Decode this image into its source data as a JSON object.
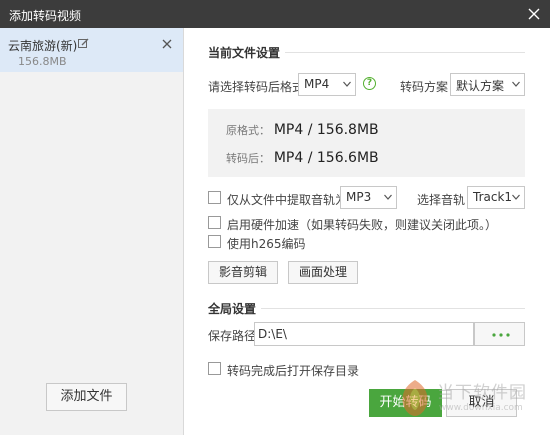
{
  "window": {
    "title": "添加转码视频"
  },
  "file_list": {
    "items": [
      {
        "name": "云南旅游(新)",
        "size": "156.8MB"
      }
    ],
    "add_button": "添加文件"
  },
  "current": {
    "title": "当前文件设置",
    "format_label": "请选择转码后格式",
    "format_value": "MP4",
    "scheme_label": "转码方案",
    "scheme_value": "默认方案",
    "orig_label": "原格式：",
    "orig_value": "MP4  /  156.8MB",
    "after_label": "转码后：",
    "after_value": "MP4  /  156.6MB",
    "extract_audio_label": "仅从文件中提取音轨为",
    "audio_format": "MP3",
    "track_label": "选择音轨",
    "track_value": "Track1",
    "hw_accel_label": "启用硬件加速（如果转码失败，则建议关闭此项。）",
    "h265_label": "使用h265编码",
    "edit_button": "影音剪辑",
    "picture_button": "画面处理"
  },
  "global": {
    "title": "全局设置",
    "save_path_label": "保存路径",
    "save_path_value": "D:\\E\\",
    "open_dir_label": "转码完成后打开保存目录"
  },
  "actions": {
    "start": "开始转码",
    "cancel": "取消"
  },
  "watermark": {
    "text": "当下软件园",
    "url": "www.downxia.com"
  },
  "colors": {
    "titlebar": "#3c3c3c",
    "accent": "#4aa63e",
    "selected": "#dde9f7"
  }
}
